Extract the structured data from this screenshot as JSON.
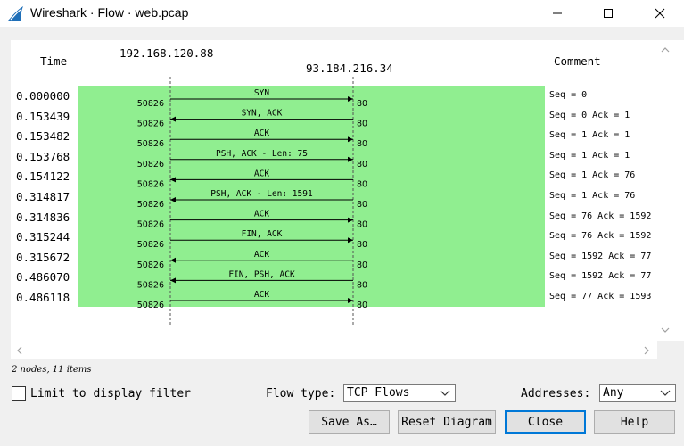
{
  "window": {
    "title": "Wireshark · Flow · web.pcap",
    "brand_color": "#1f6fb8"
  },
  "icons": {
    "app": "wireshark-fin-icon",
    "minimize": "minimize-icon",
    "maximize": "maximize-icon",
    "close": "close-icon",
    "scroll_up": "scroll-up-arrow-icon",
    "scroll_down": "scroll-down-arrow-icon",
    "scroll_left": "scroll-left-arrow-icon",
    "scroll_right": "scroll-right-arrow-icon",
    "dropdown": "chevron-down-icon"
  },
  "colors": {
    "flow_fill": "#90ee90",
    "focus": "#0078d7"
  },
  "diagram": {
    "time_header": "Time",
    "comment_header": "Comment",
    "nodes": [
      "192.168.120.88",
      "93.184.216.34"
    ],
    "rows": [
      {
        "time": "0.000000",
        "label": "SYN",
        "dir": "right",
        "src_port": "50826",
        "dst_port": "80",
        "comment": "Seq = 0"
      },
      {
        "time": "0.153439",
        "label": "SYN, ACK",
        "dir": "left",
        "src_port": "50826",
        "dst_port": "80",
        "comment": "Seq = 0 Ack = 1"
      },
      {
        "time": "0.153482",
        "label": "ACK",
        "dir": "right",
        "src_port": "50826",
        "dst_port": "80",
        "comment": "Seq = 1 Ack = 1"
      },
      {
        "time": "0.153768",
        "label": "PSH, ACK - Len: 75",
        "dir": "right",
        "src_port": "50826",
        "dst_port": "80",
        "comment": "Seq = 1 Ack = 1"
      },
      {
        "time": "0.154122",
        "label": "ACK",
        "dir": "left",
        "src_port": "50826",
        "dst_port": "80",
        "comment": "Seq = 1 Ack = 76"
      },
      {
        "time": "0.314817",
        "label": "PSH, ACK - Len: 1591",
        "dir": "left",
        "src_port": "50826",
        "dst_port": "80",
        "comment": "Seq = 1 Ack = 76"
      },
      {
        "time": "0.314836",
        "label": "ACK",
        "dir": "right",
        "src_port": "50826",
        "dst_port": "80",
        "comment": "Seq = 76 Ack = 1592"
      },
      {
        "time": "0.315244",
        "label": "FIN, ACK",
        "dir": "right",
        "src_port": "50826",
        "dst_port": "80",
        "comment": "Seq = 76 Ack = 1592"
      },
      {
        "time": "0.315672",
        "label": "ACK",
        "dir": "left",
        "src_port": "50826",
        "dst_port": "80",
        "comment": "Seq = 1592 Ack = 77"
      },
      {
        "time": "0.486070",
        "label": "FIN, PSH, ACK",
        "dir": "left",
        "src_port": "50826",
        "dst_port": "80",
        "comment": "Seq = 1592 Ack = 77"
      },
      {
        "time": "0.486118",
        "label": "ACK",
        "dir": "right",
        "src_port": "50826",
        "dst_port": "80",
        "comment": "Seq = 77 Ack = 1593"
      }
    ]
  },
  "status": "2 nodes, 11 items",
  "controls": {
    "limit_label": "Limit to display filter",
    "limit_checked": false,
    "flow_type_label": "Flow type:",
    "flow_type_value": "TCP Flows",
    "addresses_label": "Addresses:",
    "addresses_value": "Any"
  },
  "buttons": {
    "save_as": "Save As…",
    "reset_diagram": "Reset Diagram",
    "close": "Close",
    "help": "Help"
  }
}
